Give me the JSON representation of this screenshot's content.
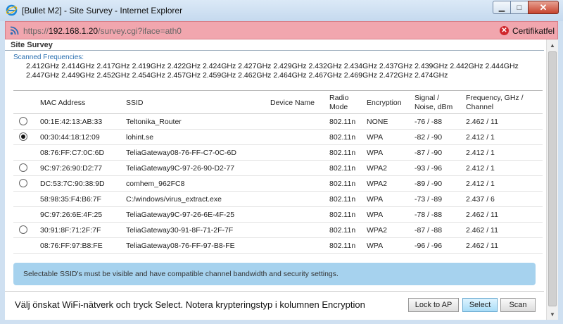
{
  "window": {
    "title": "[Bullet M2] - Site Survey - Internet Explorer",
    "controls": {
      "minimize": "▁",
      "maximize": "□",
      "close": "✕"
    }
  },
  "address": {
    "scheme": "https://",
    "host": "192.168.1.20",
    "path": "/survey.cgi?iface=ath0",
    "cert_label": "Certifikatfel",
    "cert_icon": "✕",
    "cert_color": "#d0262b",
    "bar_color": "#f1a6ae"
  },
  "survey": {
    "section_title": "Site Survey",
    "scanned_label": "Scanned Frequencies:",
    "frequencies": "2.412GHz 2.414GHz 2.417GHz 2.419GHz 2.422GHz 2.424GHz 2.427GHz 2.429GHz 2.432GHz 2.434GHz 2.437GHz 2.439GHz 2.442GHz 2.444GHz 2.447GHz 2.449GHz 2.452GHz 2.454GHz 2.457GHz 2.459GHz 2.462GHz 2.464GHz 2.467GHz 2.469GHz 2.472GHz 2.474GHz",
    "columns": {
      "mac": "MAC Address",
      "ssid": "SSID",
      "device": "Device Name",
      "radio1": "Radio",
      "radio2": "Mode",
      "encryption": "Encryption",
      "signal1": "Signal /",
      "signal2": "Noise, dBm",
      "freq1": "Frequency, GHz /",
      "freq2": "Channel"
    },
    "rows": [
      {
        "selectable": true,
        "checked": false,
        "mac": "00:1E:42:13:AB:33",
        "ssid": "Teltonika_Router",
        "device": "",
        "mode": "802.11n",
        "encryption": "NONE",
        "signal": "-76 / -88",
        "freq": "2.462 / 11"
      },
      {
        "selectable": true,
        "checked": true,
        "mac": "00:30:44:18:12:09",
        "ssid": "lohint.se",
        "device": "",
        "mode": "802.11n",
        "encryption": "WPA",
        "signal": "-82 / -90",
        "freq": "2.412 / 1"
      },
      {
        "selectable": false,
        "checked": false,
        "mac": "08:76:FF:C7:0C:6D",
        "ssid": "TeliaGateway08-76-FF-C7-0C-6D",
        "device": "",
        "mode": "802.11n",
        "encryption": "WPA",
        "signal": "-87 / -90",
        "freq": "2.412 / 1"
      },
      {
        "selectable": true,
        "checked": false,
        "mac": "9C:97:26:90:D2:77",
        "ssid": "TeliaGateway9C-97-26-90-D2-77",
        "device": "",
        "mode": "802.11n",
        "encryption": "WPA2",
        "signal": "-93 / -96",
        "freq": "2.412 / 1"
      },
      {
        "selectable": true,
        "checked": false,
        "mac": "DC:53:7C:90:38:9D",
        "ssid": "comhem_962FC8",
        "device": "",
        "mode": "802.11n",
        "encryption": "WPA2",
        "signal": "-89 / -90",
        "freq": "2.412 / 1"
      },
      {
        "selectable": false,
        "checked": false,
        "mac": "58:98:35:F4:B6:7F",
        "ssid": "C:/windows/virus_extract.exe",
        "device": "",
        "mode": "802.11n",
        "encryption": "WPA",
        "signal": "-73 / -89",
        "freq": "2.437 / 6"
      },
      {
        "selectable": false,
        "checked": false,
        "mac": "9C:97:26:6E:4F:25",
        "ssid": "TeliaGateway9C-97-26-6E-4F-25",
        "device": "",
        "mode": "802.11n",
        "encryption": "WPA",
        "signal": "-78 / -88",
        "freq": "2.462 / 11"
      },
      {
        "selectable": true,
        "checked": false,
        "mac": "30:91:8F:71:2F:7F",
        "ssid": "TeliaGateway30-91-8F-71-2F-7F",
        "device": "",
        "mode": "802.11n",
        "encryption": "WPA2",
        "signal": "-87 / -88",
        "freq": "2.462 / 11"
      },
      {
        "selectable": false,
        "checked": false,
        "mac": "08:76:FF:97:B8:FE",
        "ssid": "TeliaGateway08-76-FF-97-B8-FE",
        "device": "",
        "mode": "802.11n",
        "encryption": "WPA",
        "signal": "-96 / -96",
        "freq": "2.462 / 11"
      }
    ],
    "info": "Selectable SSID's must be visible and have compatible channel bandwidth and security settings.",
    "info_color": "#a6d2ee"
  },
  "footer": {
    "instruction": "Välj önskat WiFi-nätverk och tryck Select. Notera krypteringstyp i kolumnen Encryption",
    "lock_label": "Lock to AP",
    "select_label": "Select",
    "scan_label": "Scan"
  },
  "icons": [
    "ie-icon",
    "rss-icon",
    "cert-error-icon",
    "radio-button-icon",
    "scroll-up-icon",
    "scroll-down-icon"
  ]
}
